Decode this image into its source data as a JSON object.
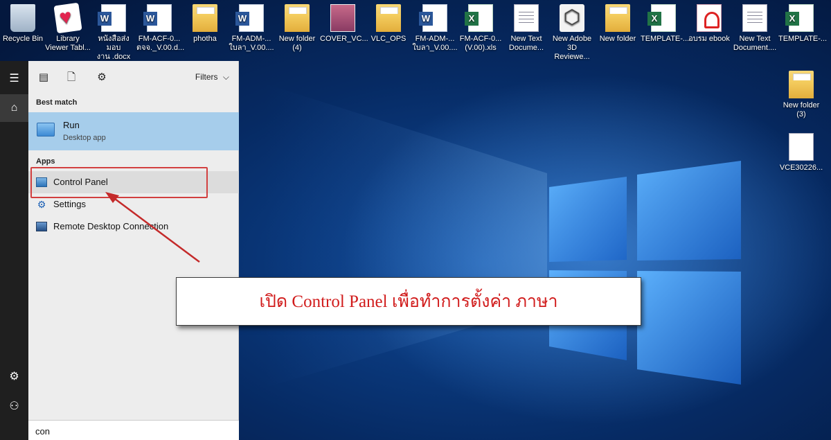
{
  "desktop": {
    "icons_top": [
      {
        "label": "Recycle Bin",
        "icon": "recycle-bin-icon",
        "kind": "recycle"
      },
      {
        "label": "Library\nViewer Tabl...",
        "icon": "library-viewer-icon",
        "kind": "lib"
      },
      {
        "label": "หนังสือส่งมอบ\nงาน .docx",
        "icon": "word-document-icon",
        "kind": "word"
      },
      {
        "label": "FM-ACF-0...\nตจจ._V.00.d...",
        "icon": "word-document-icon",
        "kind": "word"
      },
      {
        "label": "photha",
        "icon": "folder-icon",
        "kind": "folder"
      },
      {
        "label": "FM-ADM-...\nใบลา_V.00....",
        "icon": "word-document-icon",
        "kind": "word"
      },
      {
        "label": "New folder\n(4)",
        "icon": "folder-icon",
        "kind": "folder"
      },
      {
        "label": "COVER_VC...",
        "icon": "image-file-icon",
        "kind": "cover"
      },
      {
        "label": "VLC_OPS",
        "icon": "folder-icon",
        "kind": "folder"
      },
      {
        "label": "FM-ADM-...\nใบลา_V.00....",
        "icon": "word-document-icon",
        "kind": "word"
      },
      {
        "label": "FM-ACF-0...\n(V.00).xls",
        "icon": "excel-document-icon",
        "kind": "excel"
      },
      {
        "label": "New Text\nDocume...",
        "icon": "text-document-icon",
        "kind": "txt"
      },
      {
        "label": "New Adobe\n3D Reviewe...",
        "icon": "adobe-3d-icon",
        "kind": "adobe"
      },
      {
        "label": "New folder",
        "icon": "folder-icon",
        "kind": "folder"
      },
      {
        "label": "TEMPLATE-...",
        "icon": "excel-document-icon",
        "kind": "excel"
      },
      {
        "label": "อบรม ebook",
        "icon": "pdf-document-icon",
        "kind": "pdf"
      },
      {
        "label": "New Text\nDocument....",
        "icon": "text-document-icon",
        "kind": "txt"
      },
      {
        "label": "TEMPLATE-...",
        "icon": "excel-document-icon",
        "kind": "excel"
      }
    ],
    "icons_right": [
      {
        "label": "New folder\n(3)",
        "icon": "folder-icon",
        "kind": "folder"
      },
      {
        "label": "VCE30226...",
        "icon": "blank-file-icon",
        "kind": "blank"
      }
    ]
  },
  "start_menu": {
    "rail": {
      "hamburger_icon": "hamburger-menu-icon",
      "home_icon": "home-icon",
      "settings_icon": "gear-icon",
      "user_icon": "user-icon"
    },
    "toolbar": {
      "icons": [
        "documents-view-icon",
        "document-icon",
        "gear-icon"
      ],
      "filters_label": "Filters"
    },
    "best_match": {
      "heading": "Best match",
      "title": "Run",
      "subtitle": "Desktop app",
      "icon": "run-app-icon"
    },
    "apps": {
      "heading": "Apps",
      "items": [
        {
          "label": "Control Panel",
          "icon": "control-panel-icon",
          "active": true
        },
        {
          "label": "Settings",
          "icon": "gear-icon",
          "active": false
        },
        {
          "label": "Remote Desktop Connection",
          "icon": "remote-desktop-icon",
          "active": false
        }
      ]
    },
    "search": {
      "value": "con"
    }
  },
  "annotation": {
    "callout_text": "เปิด Control Panel เพื่อทำการตั้งค่า ภาษา",
    "highlight_color": "#d23f3f",
    "text_color": "#d11c1c"
  }
}
